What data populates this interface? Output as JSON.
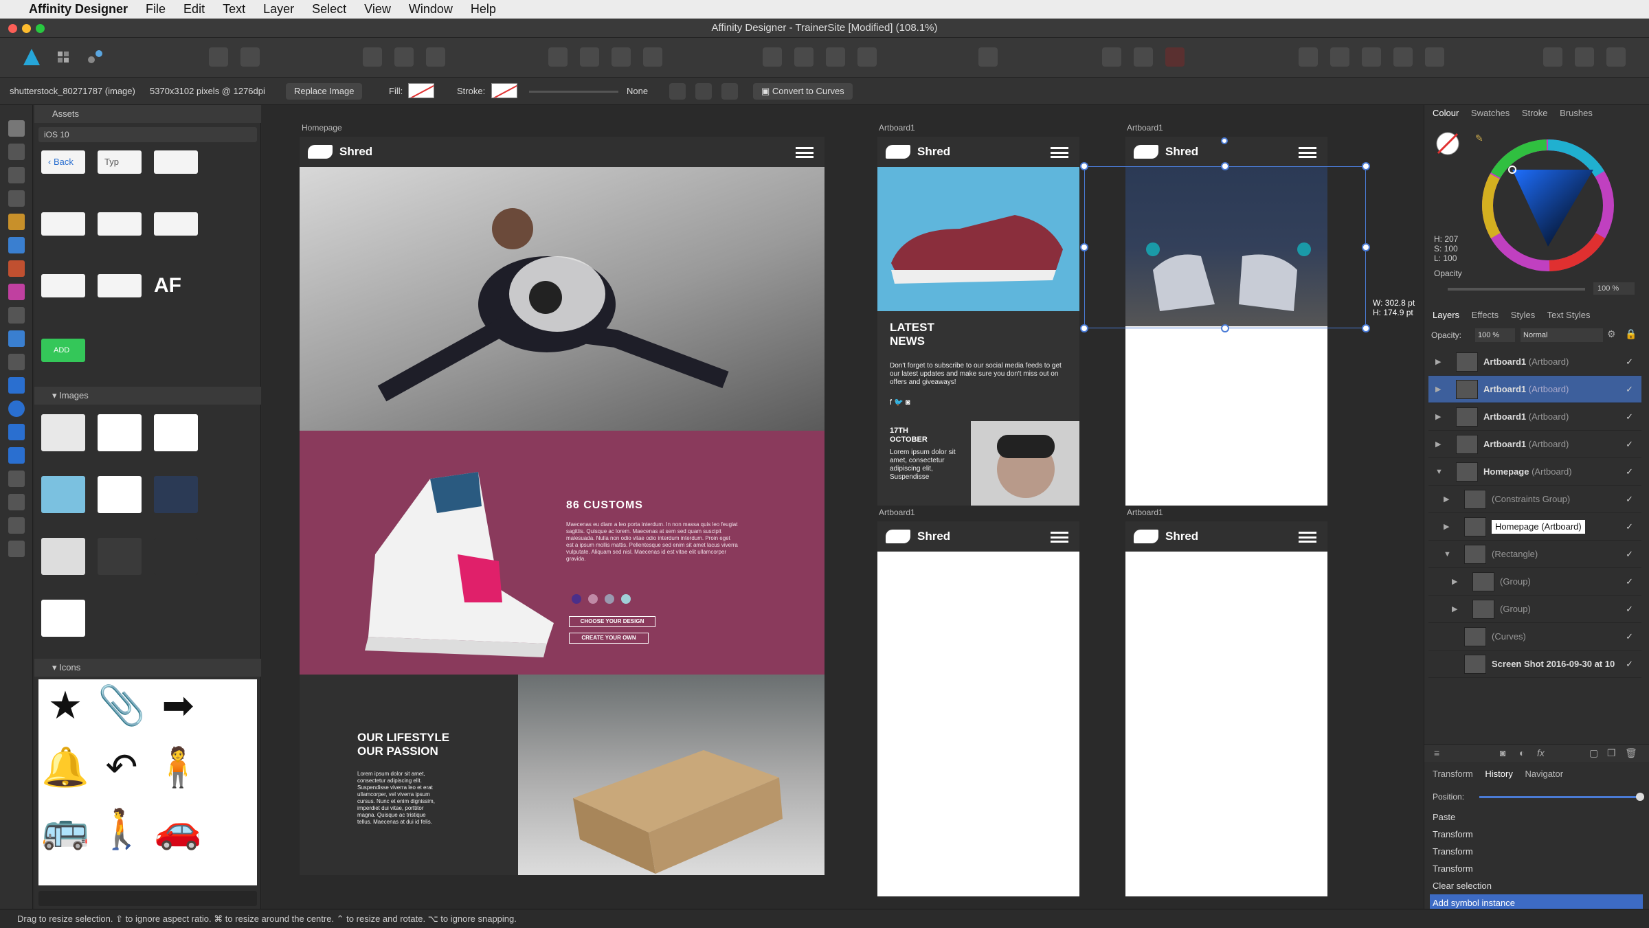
{
  "menubar": {
    "app_name": "Affinity Designer",
    "items": [
      "File",
      "Edit",
      "Text",
      "Layer",
      "Select",
      "View",
      "Window",
      "Help"
    ]
  },
  "window": {
    "title": "Affinity Designer - TrainerSite [Modified] (108.1%)"
  },
  "context": {
    "selection": "shutterstock_80271787 (image)",
    "size_info": "5370x3102 pixels @ 1276dpi",
    "replace_label": "Replace Image",
    "fill_label": "Fill:",
    "stroke_label": "Stroke:",
    "stroke_value": "None",
    "convert_label": "Convert to Curves"
  },
  "assets": {
    "title": "Assets",
    "category": "iOS 10",
    "back_label": "Back",
    "type_label": "Typ",
    "add_label": "ADD",
    "images_title": "Images",
    "icons_title": "Icons"
  },
  "artboards": {
    "homepage_label": "Homepage",
    "artboard_label": "Artboard1",
    "brand": "Shred",
    "customs_title": "86 CUSTOMS",
    "customs_body": "Maecenas eu diam a leo porta interdum. In non massa quis leo feugiat sagittis. Quisque ac lorem. Maecenas at sem sed quam suscipit malesuada. Nulla non odio vitae odio interdum interdum. Proin eget est a ipsum mollis mattis. Pellentesque sed enim sit amet lacus viverra vulputate. Aliquam sed nisl. Maecenas id est vitae elit ullamcorper gravida.",
    "choose_btn": "CHOOSE YOUR DESIGN",
    "create_btn": "CREATE YOUR OWN",
    "lifestyle_title_1": "OUR LIFESTYLE",
    "lifestyle_title_2": "OUR PASSION",
    "lifestyle_body": "Lorem ipsum dolor sit amet, consectetur adipiscing elit. Suspendisse viverra leo et erat ullamcorper, vel viverra ipsum cursus. Nunc et enim dignissim, imperdiet dui vitae, porttitor magna. Quisque ac tristique tellus. Maecenas at dui id felis.",
    "news_title_1": "LATEST",
    "news_title_2": "NEWS",
    "news_body": "Don't forget to subscribe to our social media feeds to get our latest updates and make sure you don't miss out on offers and giveaways!",
    "news_date_1": "17TH",
    "news_date_2": "OCTOBER",
    "news_small": "Lorem ipsum dolor sit amet, consectetur adipiscing elit, Suspendisse",
    "dim_w": "W: 302.8 pt",
    "dim_h": "H: 174.9 pt"
  },
  "colour": {
    "tabs": [
      "Colour",
      "Swatches",
      "Stroke",
      "Brushes"
    ],
    "h": "H: 207",
    "s": "S: 100",
    "l": "L: 100",
    "opacity_label": "Opacity",
    "opacity_value": "100 %"
  },
  "layers": {
    "tabs": [
      "Layers",
      "Effects",
      "Styles",
      "Text Styles"
    ],
    "opacity_label": "Opacity:",
    "opacity_value": "100 %",
    "blend": "Normal",
    "rows": [
      {
        "name": "Artboard1",
        "suffix": "(Artboard)"
      },
      {
        "name": "Artboard1",
        "suffix": "(Artboard)"
      },
      {
        "name": "Artboard1",
        "suffix": "(Artboard)"
      },
      {
        "name": "Artboard1",
        "suffix": "(Artboard)"
      },
      {
        "name": "Homepage",
        "suffix": "(Artboard)"
      },
      {
        "name": "",
        "suffix": "(Constraints Group)"
      },
      {
        "name": "Homepage (Artboard)",
        "suffix": ""
      },
      {
        "name": "",
        "suffix": "(Rectangle)"
      },
      {
        "name": "",
        "suffix": "(Group)"
      },
      {
        "name": "",
        "suffix": "(Group)"
      },
      {
        "name": "",
        "suffix": "(Curves)"
      },
      {
        "name": "Screen Shot 2016-09-30 at 10",
        "suffix": ""
      }
    ]
  },
  "history": {
    "tabs": [
      "Transform",
      "History",
      "Navigator"
    ],
    "position_label": "Position:",
    "items": [
      "Paste",
      "Transform",
      "Transform",
      "Transform",
      "Clear selection",
      "Add symbol instance"
    ]
  },
  "status": {
    "text": "Drag to resize selection. ⇧ to ignore aspect ratio. ⌘ to resize around the centre. ⌃ to resize and rotate. ⌥ to ignore snapping."
  },
  "accent": "#4a7bd6"
}
